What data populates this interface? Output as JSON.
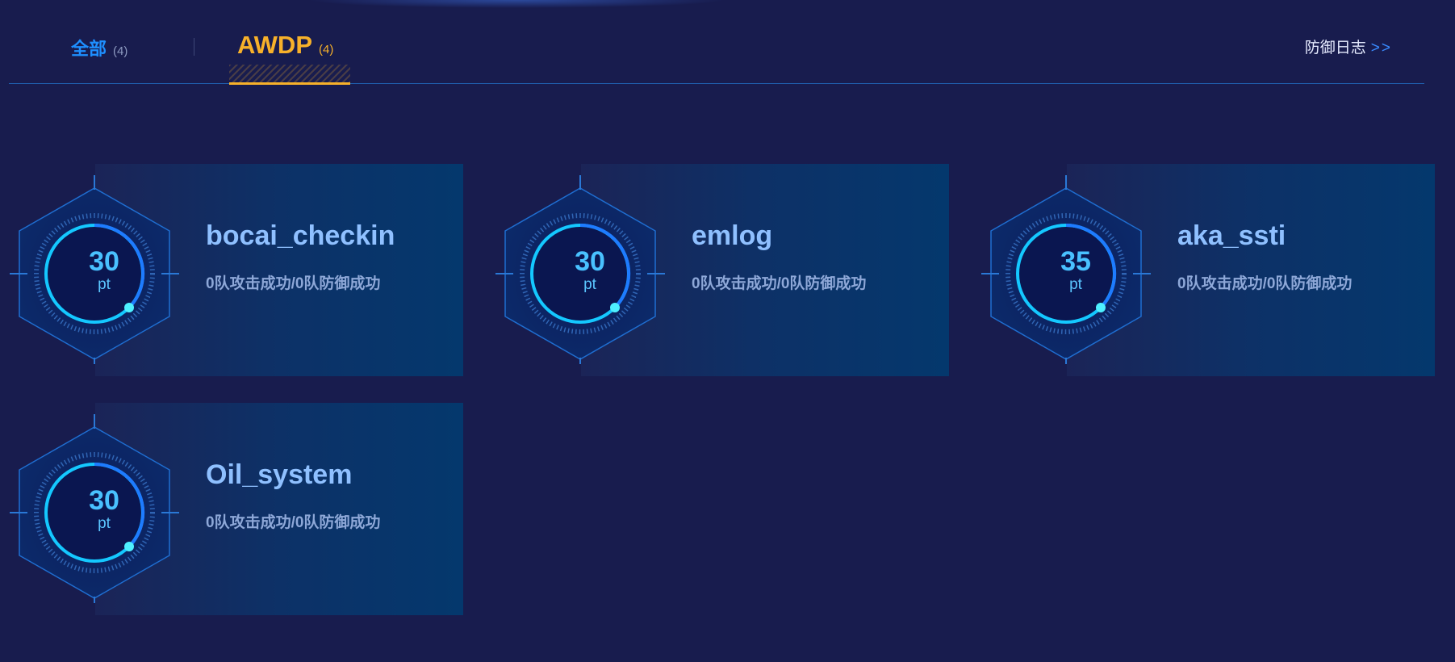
{
  "tabs": {
    "all": {
      "label": "全部",
      "count": "(4)"
    },
    "awdp": {
      "label": "AWDP",
      "count": "(4)"
    }
  },
  "defense_log": {
    "label": "防御日志",
    "arrows": ">>"
  },
  "challenges": [
    {
      "name": "bocai_checkin",
      "score": "30",
      "unit": "pt",
      "stats": "0队攻击成功/0队防御成功"
    },
    {
      "name": "emlog",
      "score": "30",
      "unit": "pt",
      "stats": "0队攻击成功/0队防御成功"
    },
    {
      "name": "aka_ssti",
      "score": "35",
      "unit": "pt",
      "stats": "0队攻击成功/0队防御成功"
    },
    {
      "name": "Oil_system",
      "score": "30",
      "unit": "pt",
      "stats": "0队攻击成功/0队防御成功"
    }
  ],
  "colors": {
    "background": "#181c4e",
    "active_tab": "#f7b12a",
    "tab_blue": "#1e8fff",
    "score": "#49c1ff"
  }
}
